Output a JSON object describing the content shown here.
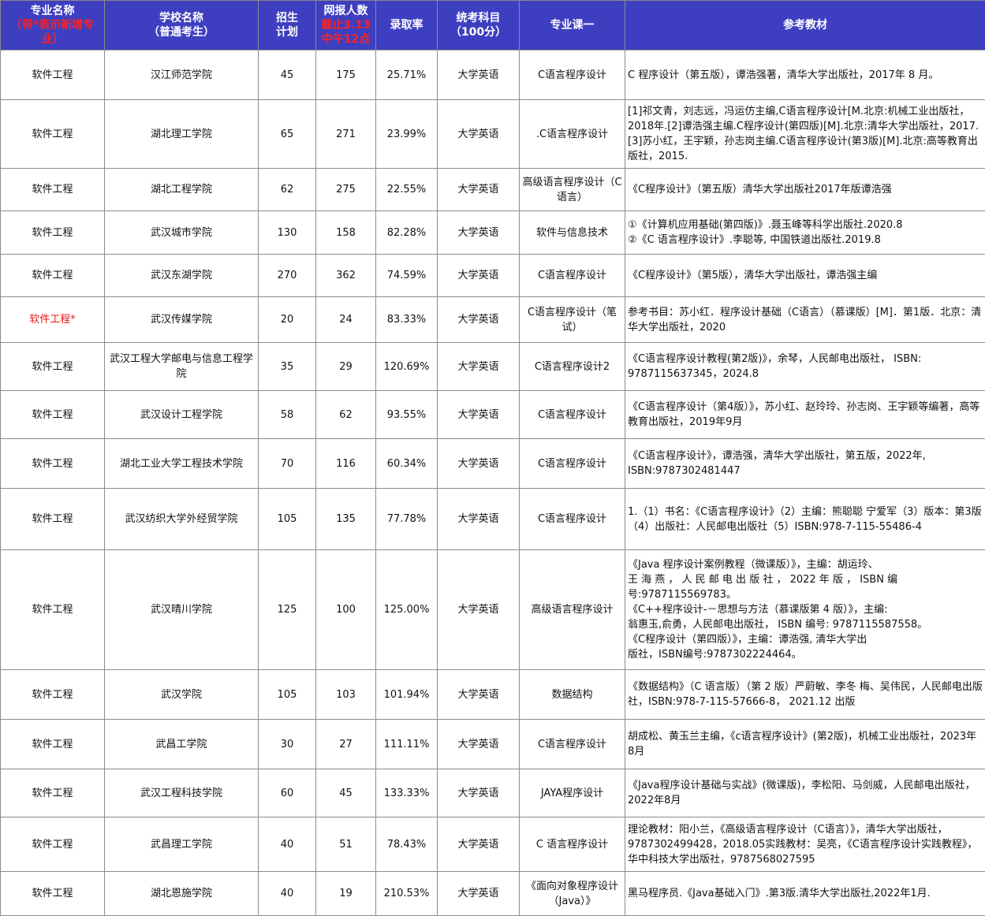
{
  "header": {
    "major": [
      "专业名称",
      "（带*表示新增专",
      "业）"
    ],
    "school": [
      "学校名称",
      "（普通考生）"
    ],
    "plan": [
      "招生",
      "计划"
    ],
    "applicants": [
      "网报人数",
      "截止3.13",
      "中午12点"
    ],
    "rate": "录取率",
    "exam": [
      "统考科目",
      "（100分）"
    ],
    "course": "专业课一",
    "textbook": "参考教材"
  },
  "rows": [
    {
      "major": "软件工程",
      "school": "汉江师范学院",
      "plan": "45",
      "applicants": "175",
      "rate": "25.71%",
      "exam": "大学英语",
      "course": "C语言程序设计",
      "textbook": "C 程序设计（第五版），谭浩强著，清华大学出版社，2017年 8 月。"
    },
    {
      "major": "软件工程",
      "school": "湖北理工学院",
      "plan": "65",
      "applicants": "271",
      "rate": "23.99%",
      "exam": "大学英语",
      "course": ".C语言程序设计",
      "textbook": "[1]祁文青，刘志远，冯运仿主编,C语言程序设计[M.北京:机械工业出版社，2018年.[2]谭浩强主编.C程序设计(第四版)[M].北京:清华大学出版社，2017.[3]苏小红，王宇颖，孙志岗主编.C语言程序设计(第3版)[M].北京:高等教育出版社，2015."
    },
    {
      "major": "软件工程",
      "school": "湖北工程学院",
      "plan": "62",
      "applicants": "275",
      "rate": "22.55%",
      "exam": "大学英语",
      "course": "高级语言程序设计（C语言）",
      "textbook": "《C程序设计》（第五版）清华大学出版社2017年版谭浩强"
    },
    {
      "major": "软件工程",
      "school": "武汉城市学院",
      "plan": "130",
      "applicants": "158",
      "rate": "82.28%",
      "exam": "大学英语",
      "course": "软件与信息技术",
      "textbook": "①《计算机应用基础(第四版)》.聂玉峰等科学出版社.2020.8\n②《C 语言程序设计》.李聪等, 中国铁道出版社.2019.8"
    },
    {
      "major": "软件工程",
      "school": "武汉东湖学院",
      "plan": "270",
      "applicants": "362",
      "rate": "74.59%",
      "exam": "大学英语",
      "course": "C语言程序设计",
      "textbook": "《C程序设计》（第5版），清华大学出版社，谭浩强主编"
    },
    {
      "major": "软件工程*",
      "school": "武汉传媒学院",
      "plan": "20",
      "applicants": "24",
      "rate": "83.33%",
      "exam": "大学英语",
      "course": "C语言程序设计（笔试）",
      "textbook": "参考书目：苏小红．程序设计基础（C语言）（慕课版）[M]．第1版．北京：清华大学出版社，2020",
      "new": true
    },
    {
      "major": "软件工程",
      "school": "武汉工程大学邮电与信息工程学院",
      "plan": "35",
      "applicants": "29",
      "rate": "120.69%",
      "exam": "大学英语",
      "course": "C语言程序设计2",
      "textbook": "《C语言程序设计教程(第2版)》，余琴，人民邮电出版社， ISBN: 9787115637345，2024.8"
    },
    {
      "major": "软件工程",
      "school": "武汉设计工程学院",
      "plan": "58",
      "applicants": "62",
      "rate": "93.55%",
      "exam": "大学英语",
      "course": "C语言程序设计",
      "textbook": "《C语言程序设计（第4版）》，苏小红、赵玲玲、孙志岗、王宇颖等编著，高等教育出版社，2019年9月"
    },
    {
      "major": "软件工程",
      "school": "湖北工业大学工程技术学院",
      "plan": "70",
      "applicants": "116",
      "rate": "60.34%",
      "exam": "大学英语",
      "course": "C语言程序设计",
      "textbook": "《C语言程序设计》，谭浩强，清华大学出版社，第五版，2022年, ISBN:9787302481447"
    },
    {
      "major": "软件工程",
      "school": "武汉纺织大学外经贸学院",
      "plan": "105",
      "applicants": "135",
      "rate": "77.78%",
      "exam": "大学英语",
      "course": "C语言程序设计",
      "textbook": "1.（1）书名：《C语言程序设计》（2）主编：熊聪聪 宁爱军（3）版本：第3版（4）出版社：人民邮电出版社（5）ISBN:978-7-115-55486-4"
    },
    {
      "major": "软件工程",
      "school": "武汉晴川学院",
      "plan": "125",
      "applicants": "100",
      "rate": "125.00%",
      "exam": "大学英语",
      "course": "高级语言程序设计",
      "textbook": "《Java 程序设计案例教程（微课版）》，主编：胡运玲、\n王 海 燕 ， 人 民 邮 电 出 版 社 ， 2022 年 版 ， ISBN 编\n号:9787115569783。\n《C++程序设计-－思想与方法（慕课版第 4 版）》，主编:\n翁惠玉,俞勇，人民邮电出版社， ISBN 编号: 9787115587558。\n《C程序设计（第四版）》，主编：谭浩强, 清华大学出\n版社，ISBN编号:9787302224464。"
    },
    {
      "major": "软件工程",
      "school": "武汉学院",
      "plan": "105",
      "applicants": "103",
      "rate": "101.94%",
      "exam": "大学英语",
      "course": "数据结构",
      "textbook": "《数据结构》（C 语言版）（第 2 版）严蔚敏、李冬 梅、吴伟民，人民邮电出版社，ISBN:978-7-115-57666-8， 2021.12 出版"
    },
    {
      "major": "软件工程",
      "school": "武昌工学院",
      "plan": "30",
      "applicants": "27",
      "rate": "111.11%",
      "exam": "大学英语",
      "course": "C语言程序设计",
      "textbook": "胡成松、黄玉兰主编，《c语言程序设计》(第2版)，机械工业出版社，2023年8月"
    },
    {
      "major": "软件工程",
      "school": "武汉工程科技学院",
      "plan": "60",
      "applicants": "45",
      "rate": "133.33%",
      "exam": "大学英语",
      "course": "JAYA程序设计",
      "textbook": "《Java程序设计基础与实战》(微课版)，李松阳、马剑威，人民邮电出版社，2022年8月"
    },
    {
      "major": "软件工程",
      "school": "武昌理工学院",
      "plan": "40",
      "applicants": "51",
      "rate": "78.43%",
      "exam": "大学英语",
      "course": "C 语言程序设计",
      "textbook": "理论教材：阳小兰，《高级语言程序设计（C语言）》，清华大学出版社，9787302499428，2018.05实践教材：吴亮，《C语言程序设计实践教程》，华中科技大学出版社，9787568027595"
    },
    {
      "major": "软件工程",
      "school": "湖北恩施学院",
      "plan": "40",
      "applicants": "19",
      "rate": "210.53%",
      "exam": "大学英语",
      "course": "《面向对象程序设计（Java）》",
      "textbook": "黑马程序员.《Java基础入门》.第3版.清华大学出版社,2022年1月."
    }
  ]
}
